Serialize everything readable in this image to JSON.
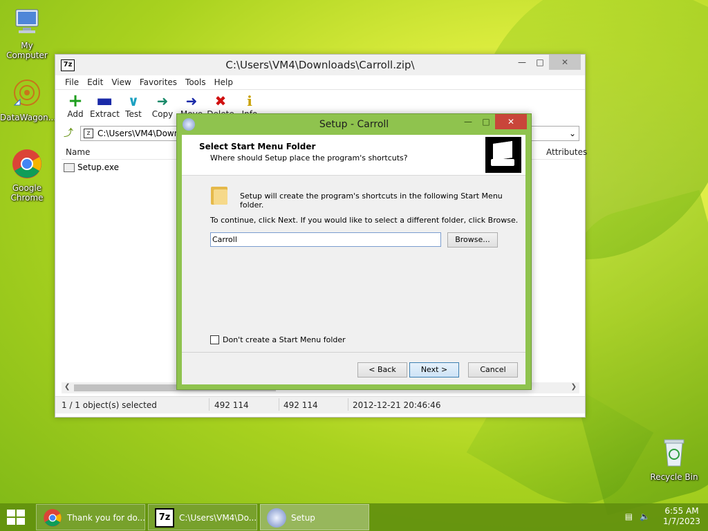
{
  "desktop": {
    "icons": [
      {
        "label": "My Computer"
      },
      {
        "label": "DataWagon..."
      },
      {
        "label": "Google Chrome"
      },
      {
        "label": "Recycle Bin"
      }
    ]
  },
  "zipwindow": {
    "title": "C:\\Users\\VM4\\Downloads\\Carroll.zip\\",
    "app_icon": "7z",
    "menu": [
      "File",
      "Edit",
      "View",
      "Favorites",
      "Tools",
      "Help"
    ],
    "toolbar": [
      {
        "label": "Add",
        "icon": "plus-icon",
        "color": "#1e9e1e"
      },
      {
        "label": "Extract",
        "icon": "minus-icon",
        "color": "#1a2aa8"
      },
      {
        "label": "Test",
        "icon": "check-icon",
        "color": "#1aa0c0"
      },
      {
        "label": "Copy",
        "icon": "copy-arrow-icon",
        "color": "#1a8a6a"
      },
      {
        "label": "Move",
        "icon": "move-arrow-icon",
        "color": "#1a2aa8"
      },
      {
        "label": "Delete",
        "icon": "delete-x-icon",
        "color": "#d01010"
      },
      {
        "label": "Info",
        "icon": "info-icon",
        "color": "#c8a000"
      }
    ],
    "address": "C:\\Users\\VM4\\Downloads\\Carroll.zip\\",
    "columns": {
      "name": "Name",
      "attributes": "Attributes"
    },
    "files": [
      {
        "name": "Setup.exe"
      }
    ],
    "status": {
      "selected": "1 / 1 object(s) selected",
      "size": "492 114",
      "packed": "492 114",
      "modified": "2012-12-21 20:46:46"
    }
  },
  "setup": {
    "title": "Setup - Carroll",
    "header_title": "Select Start Menu Folder",
    "header_subtitle": "Where should Setup place the program's shortcuts?",
    "info_text": "Setup will create the program's shortcuts in the following Start Menu folder.",
    "continue_text": "To continue, click Next. If you would like to select a different folder, click Browse.",
    "folder_value": "Carroll",
    "browse_label": "Browse...",
    "checkbox_label": "Don't create a Start Menu folder",
    "checkbox_checked": false,
    "back_label": "< Back",
    "next_label": "Next >",
    "cancel_label": "Cancel"
  },
  "taskbar": {
    "tasks": [
      {
        "label": "Thank you for do...",
        "icon": "chrome-icon"
      },
      {
        "label": "C:\\Users\\VM4\\Do...",
        "icon": "7zip-icon"
      },
      {
        "label": "Setup",
        "icon": "setup-icon"
      }
    ],
    "time": "6:55 AM",
    "date": "1/7/2023"
  }
}
